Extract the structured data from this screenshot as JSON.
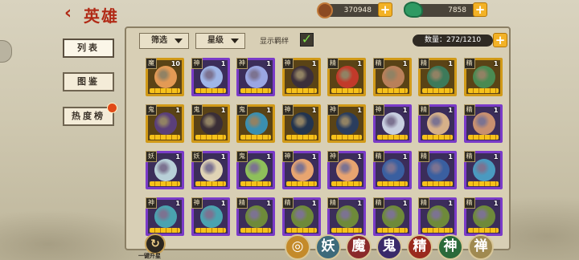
{
  "header": {
    "title": "英雄",
    "back_icon": "‹"
  },
  "resources": [
    {
      "name": "gold",
      "value": "370948",
      "icon": "coin-icon"
    },
    {
      "name": "jade",
      "value": "7858",
      "icon": "jade-icon"
    }
  ],
  "side_tabs": [
    {
      "label": "列表",
      "active": true
    },
    {
      "label": "图鉴",
      "active": false
    },
    {
      "label": "热度榜",
      "active": false
    }
  ],
  "toolbar": {
    "filter_label": "筛选",
    "star_label": "星级",
    "show_bond_label": "显示羁绊",
    "show_bond_checked": true,
    "check_mark": "✓",
    "count_text": "数量：272/1210",
    "plus": "+"
  },
  "heroes": [
    {
      "type": "魔",
      "level": "10",
      "frame": "gold",
      "color": "#e39a55"
    },
    {
      "type": "神",
      "level": "1",
      "frame": "purple",
      "color": "#9fb6e8"
    },
    {
      "type": "神",
      "level": "1",
      "frame": "purple",
      "color": "#9aa6e3"
    },
    {
      "type": "神",
      "level": "1",
      "frame": "gold",
      "color": "#3b2f3a"
    },
    {
      "type": "精",
      "level": "1",
      "frame": "gold",
      "color": "#c23a2a"
    },
    {
      "type": "精",
      "level": "1",
      "frame": "gold",
      "color": "#b9805a"
    },
    {
      "type": "精",
      "level": "1",
      "frame": "gold",
      "color": "#3d7a5a"
    },
    {
      "type": "精",
      "level": "1",
      "frame": "gold",
      "color": "#4a8a52"
    },
    {
      "type": "鬼",
      "level": "1",
      "frame": "gold",
      "color": "#5a3f7a"
    },
    {
      "type": "鬼",
      "level": "1",
      "frame": "gold",
      "color": "#3a2e36"
    },
    {
      "type": "鬼",
      "level": "1",
      "frame": "gold",
      "color": "#3a8fb0"
    },
    {
      "type": "神",
      "level": "1",
      "frame": "gold",
      "color": "#23344e"
    },
    {
      "type": "神",
      "level": "1",
      "frame": "gold",
      "color": "#2a3d5e"
    },
    {
      "type": "神",
      "level": "1",
      "frame": "purple",
      "color": "#c8cfe0"
    },
    {
      "type": "精",
      "level": "1",
      "frame": "purple",
      "color": "#d6b089"
    },
    {
      "type": "精",
      "level": "1",
      "frame": "purple",
      "color": "#c99070"
    },
    {
      "type": "妖",
      "level": "1",
      "frame": "purple",
      "color": "#b8d0d8"
    },
    {
      "type": "妖",
      "level": "1",
      "frame": "purple",
      "color": "#e0d3b5"
    },
    {
      "type": "鬼",
      "level": "1",
      "frame": "purple",
      "color": "#8ec05a"
    },
    {
      "type": "神",
      "level": "1",
      "frame": "purple",
      "color": "#e8a570"
    },
    {
      "type": "神",
      "level": "1",
      "frame": "purple",
      "color": "#e7a370"
    },
    {
      "type": "精",
      "level": "1",
      "frame": "purple",
      "color": "#3a5fa0"
    },
    {
      "type": "精",
      "level": "1",
      "frame": "purple",
      "color": "#3a5fa0"
    },
    {
      "type": "精",
      "level": "1",
      "frame": "purple",
      "color": "#4a9ac0"
    },
    {
      "type": "神",
      "level": "1",
      "frame": "purple",
      "color": "#4aa3b0"
    },
    {
      "type": "神",
      "level": "1",
      "frame": "purple",
      "color": "#4aa3b0"
    },
    {
      "type": "精",
      "level": "1",
      "frame": "purple",
      "color": "#6e8a3a"
    },
    {
      "type": "精",
      "level": "1",
      "frame": "purple",
      "color": "#6e8a3a"
    },
    {
      "type": "精",
      "level": "1",
      "frame": "purple",
      "color": "#6e8a3a"
    },
    {
      "type": "精",
      "level": "1",
      "frame": "purple",
      "color": "#6e8a3a"
    },
    {
      "type": "精",
      "level": "1",
      "frame": "purple",
      "color": "#6e8a3a"
    },
    {
      "type": "精",
      "level": "1",
      "frame": "purple",
      "color": "#6e8a3a"
    }
  ],
  "bottom": {
    "upgrade_label": "一键升星",
    "upgrade_icon": "↻",
    "faction_filters": [
      {
        "label": "◎",
        "name": "all",
        "color": "#c48a2a"
      },
      {
        "label": "妖",
        "name": "yao",
        "color": "#3d6a7a"
      },
      {
        "label": "魔",
        "name": "mo",
        "color": "#8a2a2a"
      },
      {
        "label": "鬼",
        "name": "gui",
        "color": "#3a2a6a"
      },
      {
        "label": "精",
        "name": "jing",
        "color": "#9a2a1e"
      },
      {
        "label": "神",
        "name": "shen",
        "color": "#2a6a3a"
      },
      {
        "label": "禅",
        "name": "chan",
        "color": "#a08a50"
      }
    ]
  }
}
